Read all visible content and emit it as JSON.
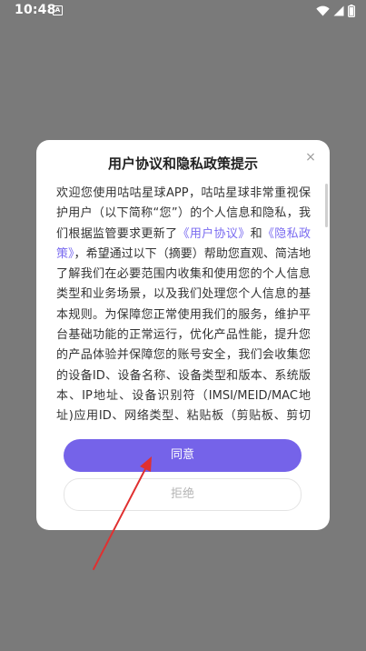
{
  "status_bar": {
    "time": "10:48",
    "notif_letter": "A"
  },
  "dialog": {
    "title": "用户协议和隐私政策提示",
    "close_glyph": "×",
    "body": {
      "p1": "欢迎您使用咕咕星球APP，咕咕星球非常重视保护用户（以下简称“您”）的个人信息和隐私，我们根据监管要求更新了",
      "link_user_agreement": "《用户协议》",
      "conj": "和",
      "link_privacy_policy": "《隐私政策》",
      "p2": "，希望通过以下（摘要）帮助您直观、简洁地了解我们在必要范围内收集和使用您的个人信息类型和业务场景，以及我们处理您个人信息的基本规则。",
      "p3": "为保障您正常使用我们的服务，维护平台基础功能的正常运行，优化产品性能，提升您的产品体验并保障您的账号安全，我们会收集您的设备ID、设备名称、设备类型和版本、系统版本、IP地址、设备识别符（IMSI/MEID/MAC地址)应用ID、网络类型、粘贴板（剪贴板、剪切板）、SIM卡、"
    },
    "agree_label": "同意",
    "reject_label": "拒绝"
  },
  "colors": {
    "accent": "#7563e9",
    "link": "#7a6bf0",
    "annotation_arrow": "#e03030"
  }
}
